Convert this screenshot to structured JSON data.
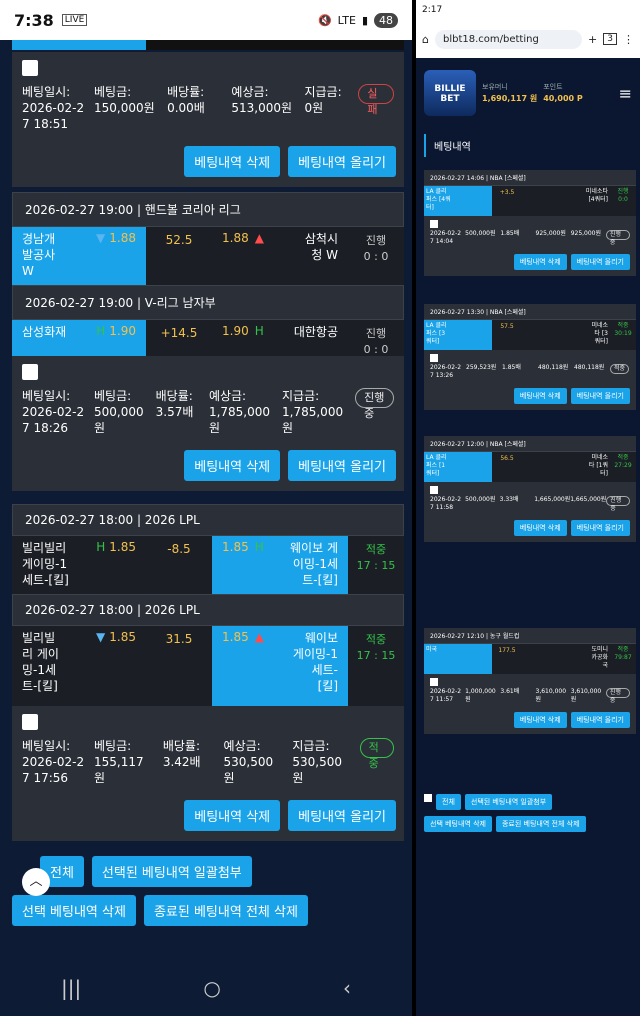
{
  "left_status": {
    "time": "7:38",
    "live": "LIVE",
    "battery": "48",
    "network": "LTE"
  },
  "bets": [
    {
      "info": {
        "labels": [
          "베팅일시:",
          "베팅금:",
          "배당률:",
          "예상금:",
          "지급금:"
        ],
        "values": [
          "2026-02-2\n7 18:51",
          "150,000원",
          "0.00배",
          "513,000원",
          "0원"
        ],
        "status": "실패"
      },
      "buttons": [
        "베팅내역 삭제",
        "베팅내역 올리기"
      ]
    },
    {
      "games": [
        {
          "head": "2026-02-27 19:00 | 핸드볼 코리아 리그",
          "home": "경남개\n발공사\nW",
          "home_odds": "1.88",
          "mid": "52.5",
          "away_odds": "1.88",
          "away": "삼척시\n청 W",
          "status": "진행\n0 : 0"
        },
        {
          "head": "2026-02-27 19:00 | V-리그 남자부",
          "home": "삼성화재",
          "home_odds": "1.90",
          "mid": "+14.5",
          "away_odds": "1.90",
          "away": "대한항공",
          "status": "진행\n0 : 0"
        }
      ],
      "info": {
        "values": [
          "2026-02-2\n7 18:26",
          "500,000원",
          "3.57배",
          "1,785,000\n원",
          "1,785,000\n원"
        ],
        "status": "진행중"
      },
      "buttons": [
        "베팅내역 삭제",
        "베팅내역 올리기"
      ]
    },
    {
      "games": [
        {
          "head": "2026-02-27 18:00 | 2026 LPL",
          "home": "빌리빌리\n게이밍-1\n세트-[킬]",
          "home_odds": "1.85",
          "mid": "-8.5",
          "away_odds": "1.85",
          "away": "웨이보 게\n이밍-1세\n트-[킬]",
          "status": "적중\n17 : 15"
        },
        {
          "head": "2026-02-27 18:00 | 2026 LPL",
          "home": "빌리빌\n리 게이\n밍-1세\n트-[킬]",
          "home_odds": "1.85",
          "mid": "31.5",
          "away_odds": "1.85",
          "away": "웨이보\n게이밍-1\n세트-\n[킬]",
          "status": "적중\n17 : 15"
        }
      ],
      "info": {
        "values": [
          "2026-02-2\n7 17:56",
          "155,117원",
          "3.42배",
          "530,500원",
          "530,500원"
        ],
        "status": "적중"
      },
      "buttons": [
        "베팅내역 삭제",
        "베팅내역 올리기"
      ]
    }
  ],
  "bottom": {
    "all": "전체",
    "attach": "선택된 베팅내역 일괄첨부",
    "delete_sel": "선택 베팅내역 삭제",
    "delete_done": "종료된 베팅내역 전체 삭제",
    "top": "TOP"
  },
  "right": {
    "status_time": "2:17",
    "url": "blbt18.com/betting",
    "tabs": "3",
    "logo": "BILLIE BET",
    "balance_label": "보유머니",
    "balance": "1,690,117 원",
    "point_label": "포인트",
    "point": "40,000 P",
    "title": "베팅내역",
    "bets": [
      {
        "head": "2026-02-27 14:06 | NBA [스페셜]",
        "home": "LA 클리\n퍼스 [4쿼\n터]",
        "odds": "1.85",
        "mid": "+3.5",
        "away": "미네소타\n[4쿼터]",
        "status": "진행\n0:0",
        "info": [
          "2026-02-2\n7 14:04",
          "500,000원",
          "1.85배",
          "925,000원",
          "925,000원"
        ],
        "badge": "진행중"
      },
      {
        "head": "2026-02-27 13:30 | NBA [스페셜]",
        "home": "LA 클리\n퍼스 [3\n쿼터]",
        "odds": "1.85",
        "mid": "57.5",
        "away": "미네소\n타 [3\n쿼터]",
        "status": "적중\n30:19",
        "info": [
          "2026-02-2\n7 13:26",
          "259,523원",
          "1.85배",
          "480,118원",
          "480,118원"
        ],
        "badge": "적중"
      },
      {
        "head": "2026-02-27 12:00 | NBA [스페셜]",
        "home": "LA 클리\n퍼스 [1\n쿼터]",
        "odds": "1.85",
        "mid": "56.5",
        "away": "미네소\n타 [1쿼\n터]",
        "status": "적중\n27:29",
        "info": [
          "2026-02-2\n7 11:58",
          "500,000원",
          "3.33배",
          "1,665,000원",
          "1,665,000원"
        ],
        "badge": "진행중"
      },
      {
        "head": "2026-02-27 12:10 | 농구 월드컵",
        "home": "미국",
        "odds": "1.90",
        "mid": "177.5",
        "away": "도미니\n카공화\n국",
        "status": "적중\n79:87",
        "info": [
          "2026-02-2\n7 11:57",
          "1,000,000\n원",
          "3.61배",
          "3,610,000\n원",
          "3,610,000\n원"
        ],
        "badge": "진행중"
      }
    ],
    "bottom": {
      "all": "전체",
      "attach": "선택된 베팅내역 일괄첨부",
      "delete_sel": "선택 베팅내역 삭제",
      "delete_done": "종료된 베팅내역 전체 삭제"
    }
  }
}
